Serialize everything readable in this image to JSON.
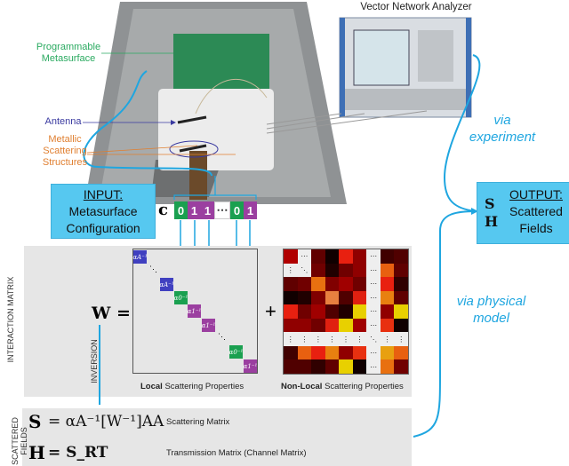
{
  "photo": {
    "vna_title": "Vector Network Analyzer",
    "labels": {
      "metasurface": "Programmable Metasurface",
      "antenna": "Antenna",
      "scatterers": "Metallic Scattering Structures"
    },
    "label_colors": {
      "metasurface": "#2aaa60",
      "antenna": "#3a3aa0",
      "scatterers": "#e07f30"
    }
  },
  "via_experiment": "via experiment",
  "via_model": "via physical model",
  "input": {
    "heading": "INPUT:",
    "text": "Metasurface Configuration",
    "symbol": "c =",
    "bits": [
      "0",
      "1",
      "1",
      "⋯",
      "0",
      "1"
    ]
  },
  "output": {
    "heading": "OUTPUT:",
    "text": "Scattered Fields",
    "symbols": [
      "S",
      "H"
    ]
  },
  "interaction": {
    "side_label": "INTERACTION MATRIX",
    "lhs": "W =",
    "plus": "+",
    "inversion": "INVERSION",
    "diagonal": [
      "αA⁻¹",
      "αA⁻¹",
      "α0⁻¹",
      "α1⁻¹",
      "α1⁻¹",
      "α0⁻¹",
      "α1⁻¹"
    ],
    "local_caption_bold": "Local",
    "nonlocal_caption_bold": "Non-Local",
    "caption_rest": " Scattering Properties"
  },
  "scattered": {
    "side_label": "SCATTERED FIELDS",
    "eq1": {
      "lhs": "S",
      "rhs": "= αA⁻¹[W⁻¹]AA",
      "desc": "Scattering Matrix"
    },
    "eq2": {
      "lhs": "H",
      "rhs": "= S_RT",
      "desc": "Transmission Matrix (Channel Matrix)"
    }
  },
  "colors": {
    "accent": "#1fa6e0",
    "box": "#56c8f0",
    "green": "#1aa050",
    "purple": "#9b3fa0",
    "blue": "#4040c0"
  }
}
